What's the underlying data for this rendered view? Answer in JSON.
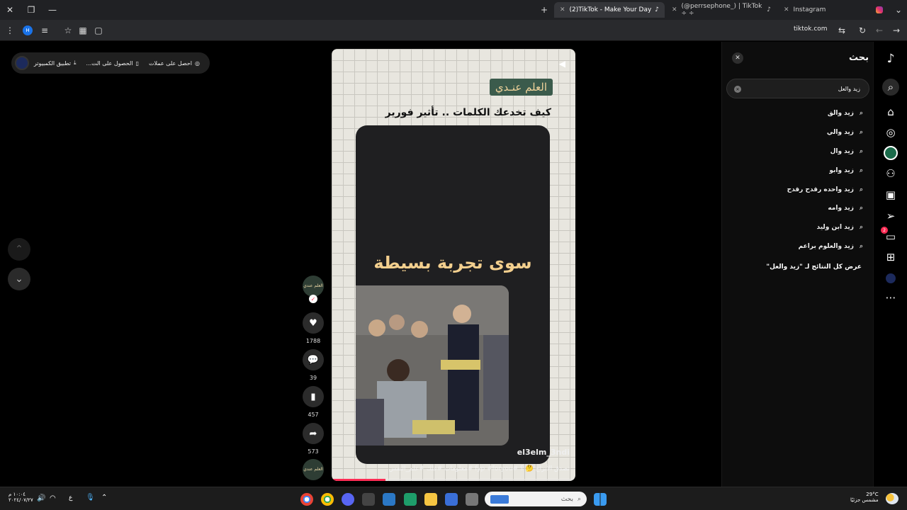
{
  "browser": {
    "tabs": [
      {
        "title": "(2)TikTok - Make Your Day",
        "active": true
      },
      {
        "title": "(@perrsephone_) | TikTok ÷ ÷",
        "active": false
      },
      {
        "title": "Instagram",
        "active": false
      }
    ],
    "address": "tiktok.com"
  },
  "top_pill": {
    "coins": "احصل على عملات",
    "get_app": "الحصول على الت...",
    "desktop_app": "تطبيق الكمبيوتر"
  },
  "video": {
    "brand_label": "العلم عنـدي",
    "headline": "كيف تخدعك الكلمات .. تأثير فورير",
    "board_text": "سوى تجربة بسيطة",
    "watermark": "el3elm_3ndi",
    "caption": "تصدق الأبراج 🤔 ؟ #fyp #foryou #معلومات #فلك #علم_النفس",
    "progress": 0.22
  },
  "actions": {
    "avatar_text": "العلم عندي",
    "likes": "1788",
    "comments": "39",
    "saves": "457",
    "shares": "573"
  },
  "search": {
    "title": "بحث",
    "query": "زيد والعل",
    "suggestions": [
      "زيد والق",
      "زيد والي",
      "زيد وال",
      "زيد وابو",
      "زيد واحده رقدح رقدح",
      "زيد وامه",
      "زيد ابن وليد",
      "زيد والعلوم براعم"
    ],
    "see_all": "عرض كل النتائج لـ \"زيد والعل\""
  },
  "sidebar": {
    "messages_badge": "2"
  },
  "taskbar": {
    "search_placeholder": "بحث",
    "time": "١٠:٠٤ م",
    "date": "٢٠٢٤/٠٧/٢٧",
    "lang": "ع",
    "weather_temp": "29°C",
    "weather_desc": "مشمس جزئيًا"
  }
}
